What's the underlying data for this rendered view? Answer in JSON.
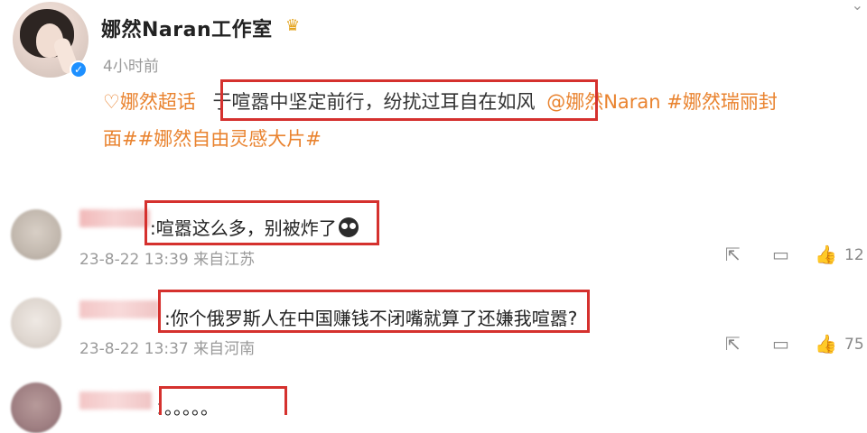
{
  "post": {
    "author": "娜然Naran工作室",
    "badge_icon": "crown-icon",
    "time": "4小时前",
    "line1": {
      "super_topic": "娜然超话",
      "quote": "于喧嚣中坚定前行，纷扰过耳自在如风",
      "mention_and_tag": "@娜然Naran #娜然瑞丽封"
    },
    "line2": "面##娜然自由灵感大片#"
  },
  "comments": [
    {
      "text": ":喧嚣这么多，别被炸了",
      "meta": "23-8-22 13:39 来自江苏",
      "likes": "12"
    },
    {
      "text": ":你个俄罗斯人在中国赚钱不闭嘴就算了还嫌我喧嚣?",
      "meta": "23-8-22 13:37 来自河南",
      "likes": "75"
    },
    {
      "text": "：。。。。。"
    }
  ],
  "colors": {
    "accent": "#e9832f",
    "highlight_box": "#d5312e",
    "verified": "#1e90ff"
  }
}
